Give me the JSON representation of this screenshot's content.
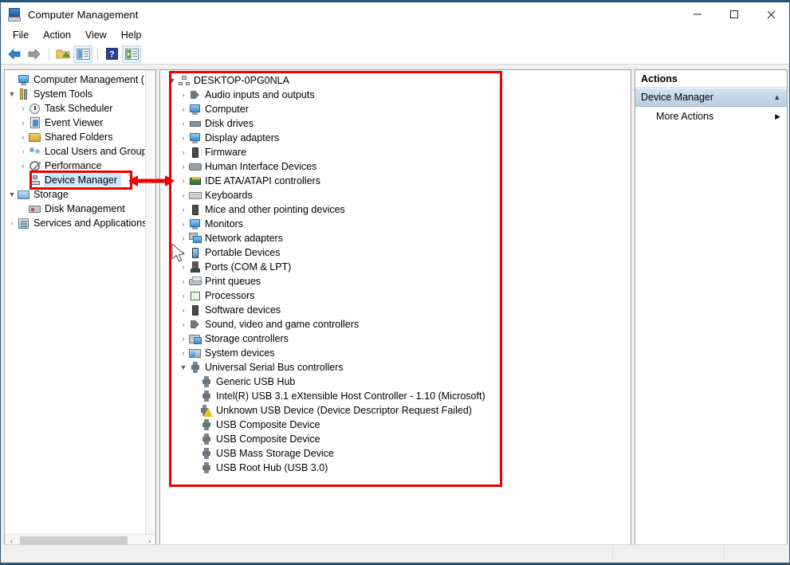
{
  "window": {
    "title": "Computer Management",
    "icon": "computer-management-icon",
    "controls": {
      "minimize": "–",
      "maximize": "□",
      "close": "×"
    }
  },
  "menu": {
    "items": [
      "File",
      "Action",
      "View",
      "Help"
    ]
  },
  "toolbar": {
    "buttons": [
      {
        "name": "back-button",
        "icon": "back-arrow-icon"
      },
      {
        "name": "forward-button",
        "icon": "forward-arrow-icon"
      },
      {
        "name": "up-one-level-button",
        "icon": "folder-up-icon"
      },
      {
        "name": "show-hide-console-tree-button",
        "icon": "console-tree-icon"
      },
      {
        "name": "help-button",
        "icon": "help-question-icon"
      },
      {
        "name": "show-hide-action-pane-button",
        "icon": "action-pane-icon"
      }
    ]
  },
  "sidebar": {
    "items": [
      {
        "label": "Computer Management (Local",
        "indent": 1,
        "chevron": "",
        "icon": "computer-management-icon",
        "selected": false
      },
      {
        "label": "System Tools",
        "indent": 1,
        "chevron": "▼",
        "icon": "system-tools-icon",
        "selected": false
      },
      {
        "label": "Task Scheduler",
        "indent": 2,
        "chevron": "›",
        "icon": "task-scheduler-icon",
        "selected": false
      },
      {
        "label": "Event Viewer",
        "indent": 2,
        "chevron": "›",
        "icon": "event-viewer-icon",
        "selected": false
      },
      {
        "label": "Shared Folders",
        "indent": 2,
        "chevron": "›",
        "icon": "shared-folders-icon",
        "selected": false
      },
      {
        "label": "Local Users and Groups",
        "indent": 2,
        "chevron": "›",
        "icon": "local-users-icon",
        "selected": false
      },
      {
        "label": "Performance",
        "indent": 2,
        "chevron": "›",
        "icon": "performance-icon",
        "selected": false
      },
      {
        "label": "Device Manager",
        "indent": 2,
        "chevron": "",
        "icon": "device-manager-icon",
        "selected": true
      },
      {
        "label": "Storage",
        "indent": 1,
        "chevron": "▼",
        "icon": "storage-icon",
        "selected": false
      },
      {
        "label": "Disk Management",
        "indent": 2,
        "chevron": "",
        "icon": "disk-management-icon",
        "selected": false
      },
      {
        "label": "Services and Applications",
        "indent": 1,
        "chevron": "›",
        "icon": "services-applications-icon",
        "selected": false
      }
    ],
    "hscroll": {
      "left_arrow": "‹",
      "right_arrow": "›"
    }
  },
  "device_tree": {
    "root": {
      "label": "DESKTOP-0PG0NLA",
      "chevron": "▼",
      "icon": "computer-node-icon"
    },
    "categories": [
      {
        "label": "Audio inputs and outputs",
        "chevron": "›",
        "icon": "speaker-icon"
      },
      {
        "label": "Computer",
        "chevron": "›",
        "icon": "monitor-icon"
      },
      {
        "label": "Disk drives",
        "chevron": "›",
        "icon": "disk-drive-icon"
      },
      {
        "label": "Display adapters",
        "chevron": "›",
        "icon": "display-adapter-icon"
      },
      {
        "label": "Firmware",
        "chevron": "›",
        "icon": "firmware-icon"
      },
      {
        "label": "Human Interface Devices",
        "chevron": "›",
        "icon": "hid-icon"
      },
      {
        "label": "IDE ATA/ATAPI controllers",
        "chevron": "›",
        "icon": "ide-controller-icon"
      },
      {
        "label": "Keyboards",
        "chevron": "›",
        "icon": "keyboard-icon"
      },
      {
        "label": "Mice and other pointing devices",
        "chevron": "›",
        "icon": "mouse-icon"
      },
      {
        "label": "Monitors",
        "chevron": "›",
        "icon": "monitor-icon"
      },
      {
        "label": "Network adapters",
        "chevron": "›",
        "icon": "network-adapter-icon"
      },
      {
        "label": "Portable Devices",
        "chevron": "›",
        "icon": "portable-device-icon"
      },
      {
        "label": "Ports (COM & LPT)",
        "chevron": "›",
        "icon": "port-icon"
      },
      {
        "label": "Print queues",
        "chevron": "›",
        "icon": "printer-icon"
      },
      {
        "label": "Processors",
        "chevron": "›",
        "icon": "processor-icon"
      },
      {
        "label": "Software devices",
        "chevron": "›",
        "icon": "software-device-icon"
      },
      {
        "label": "Sound, video and game controllers",
        "chevron": "›",
        "icon": "speaker-icon"
      },
      {
        "label": "Storage controllers",
        "chevron": "›",
        "icon": "storage-controller-icon"
      },
      {
        "label": "System devices",
        "chevron": "›",
        "icon": "system-device-icon"
      },
      {
        "label": "Universal Serial Bus controllers",
        "chevron": "▼",
        "icon": "usb-icon"
      }
    ],
    "usb_devices": [
      {
        "label": "Generic USB Hub",
        "icon": "usb-icon",
        "warning": false
      },
      {
        "label": "Intel(R) USB 3.1 eXtensible Host Controller - 1.10 (Microsoft)",
        "icon": "usb-icon",
        "warning": false
      },
      {
        "label": "Unknown USB Device (Device Descriptor Request Failed)",
        "icon": "usb-warning-icon",
        "warning": true
      },
      {
        "label": "USB Composite Device",
        "icon": "usb-icon",
        "warning": false
      },
      {
        "label": "USB Composite Device",
        "icon": "usb-icon",
        "warning": false
      },
      {
        "label": "USB Mass Storage Device",
        "icon": "usb-icon",
        "warning": false
      },
      {
        "label": "USB Root Hub (USB 3.0)",
        "icon": "usb-icon",
        "warning": false
      }
    ]
  },
  "actions_pane": {
    "header": "Actions",
    "section": {
      "label": "Device Manager",
      "caret": "▲"
    },
    "items": [
      {
        "label": "More Actions",
        "caret": "▶"
      }
    ]
  },
  "annotations": {
    "highlight_color": "#ee0000",
    "selection_color": "#cce8ff",
    "boxes": [
      {
        "name": "device-manager-highlight-box"
      },
      {
        "name": "device-tree-highlight-box"
      }
    ],
    "arrow": {
      "name": "double-headed-arrow",
      "direction": "left-right"
    }
  }
}
